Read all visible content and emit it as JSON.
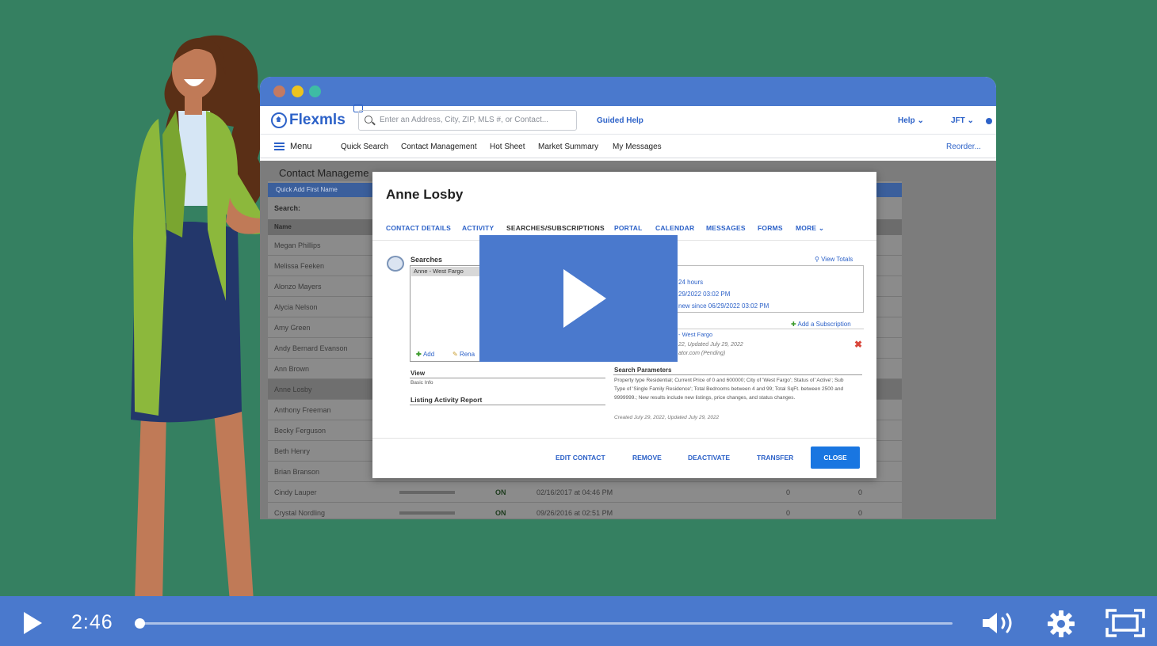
{
  "app": {
    "logo": "Flexmls",
    "search_placeholder": "Enter an Address, City, ZIP, MLS #, or Contact...",
    "guided_help": "Guided Help",
    "help": "Help",
    "user": "JFT"
  },
  "menu": {
    "menu_label": "Menu",
    "items": [
      "Quick Search",
      "Contact Management",
      "Hot Sheet",
      "Market Summary",
      "My Messages"
    ],
    "reorder": "Reorder..."
  },
  "bgpage": {
    "title": "Contact Manageme",
    "quick_add": "Quick Add First Name",
    "search_label": "Search:",
    "name_header": "Name",
    "contacts": [
      "Megan Phillips",
      "Melissa Feeken",
      "Alonzo Mayers",
      "Alycia Nelson",
      "Amy Green",
      "Andy Bernard Evanson",
      "Ann Brown",
      "Anne Losby",
      "Anthony Freeman",
      "Becky Ferguson",
      "Beth Henry",
      "Brian Branson",
      "Cindy Lauper",
      "Crystal Nordling"
    ],
    "row_status": "ON",
    "row_date_1": "02/16/2017 at 04:46 PM",
    "row_date_2": "09/26/2016 at 02:51 PM",
    "row_zero": "0"
  },
  "modal": {
    "title": "Anne Losby",
    "tabs": [
      "CONTACT DETAILS",
      "ACTIVITY",
      "SEARCHES/SUBSCRIPTIONS",
      "PORTAL",
      "CALENDAR",
      "MESSAGES",
      "FORMS",
      "MORE"
    ],
    "searches_label": "Searches",
    "search_item": "Anne - West Fargo",
    "add_label": "Add",
    "rename_label": "Rena",
    "view_totals": "View Totals",
    "totals": [
      "24 hours",
      "29/2022 03:02 PM",
      "new since 06/29/2022 03:02 PM"
    ],
    "add_subscription": "Add a Subscription",
    "sub_name": "- West Fargo",
    "sub_dates": "22, Updated July 29, 2022",
    "sub_status": "ator.com (Pending)",
    "view_label": "View",
    "view_value": "Basic Info",
    "listing_activity": "Listing Activity Report",
    "search_params_label": "Search Parameters",
    "search_params_text": "Property type Residential; Current Price of 0 and 600000; City of 'West Fargo'; Status of 'Active'; Sub Type of 'Single Family Residence'; Total Bedrooms between 4 and 99; Total SqFt. between 2500 and 9999999.; New results include new listings, price changes, and status changes.",
    "created": "Created July 29, 2022, Updated July 29, 2022",
    "buttons": {
      "edit": "EDIT CONTACT",
      "remove": "REMOVE",
      "deactivate": "DEACTIVATE",
      "transfer": "TRANSFER",
      "close": "CLOSE"
    }
  },
  "player": {
    "time": "2:46",
    "progress_percent": 0
  },
  "colors": {
    "background": "#358061",
    "accent": "#4a79cd",
    "link": "#2d62c8",
    "close_button": "#1976e1"
  }
}
